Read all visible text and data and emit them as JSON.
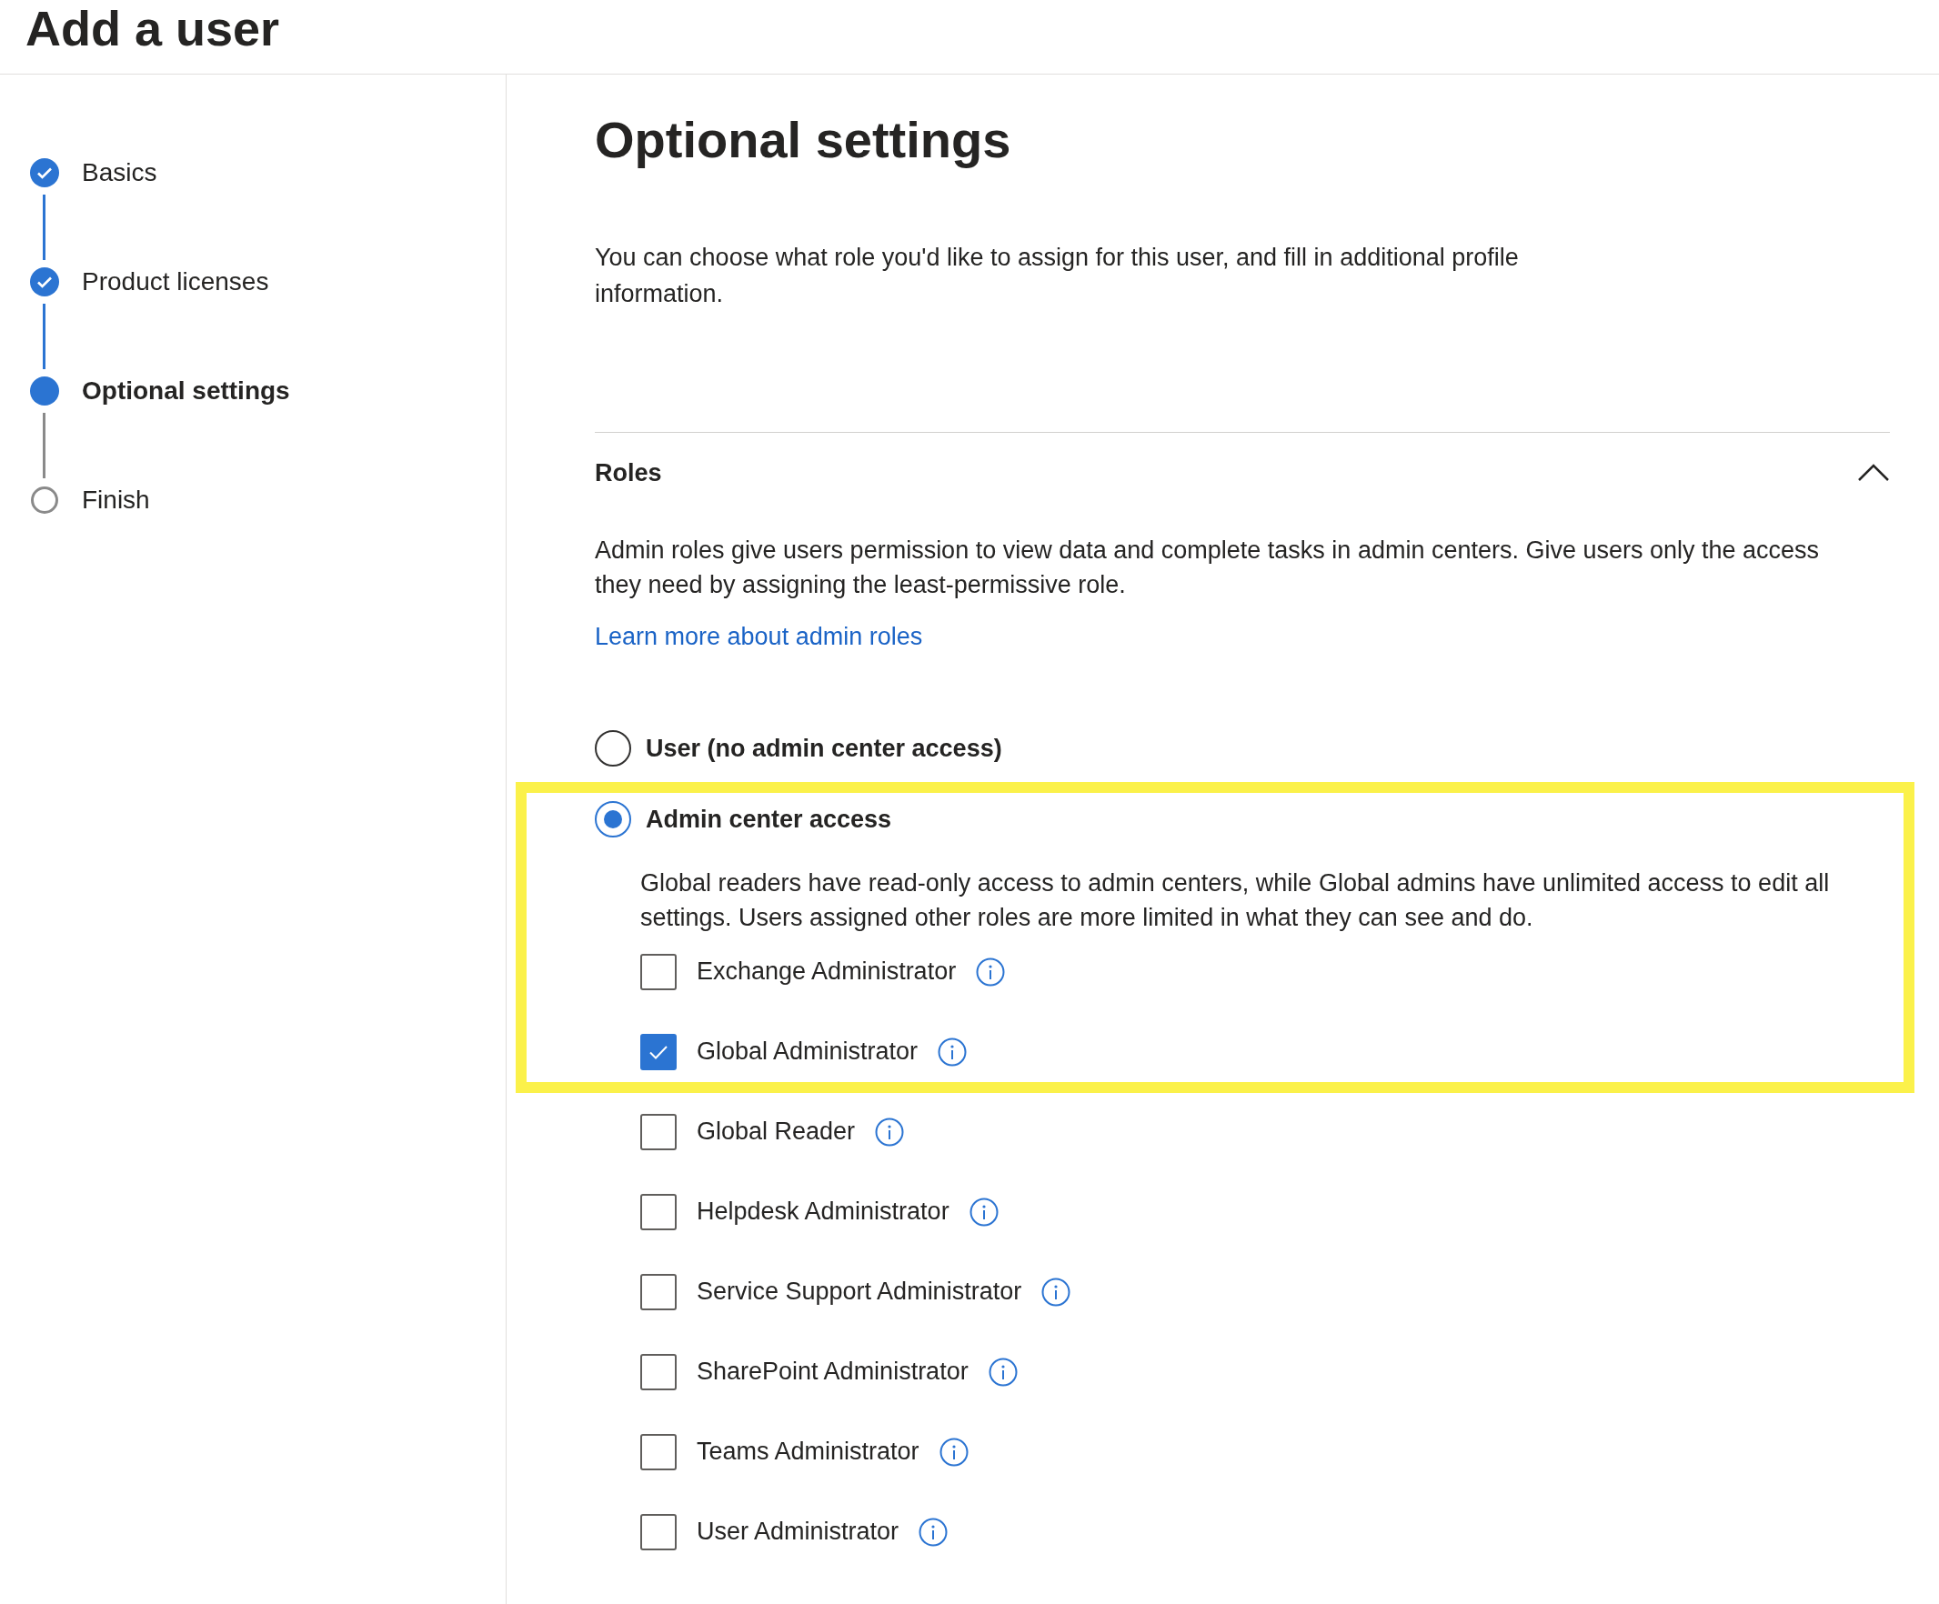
{
  "header": {
    "title": "Add a user"
  },
  "steps": [
    {
      "label": "Basics",
      "completed": true,
      "current": false
    },
    {
      "label": "Product licenses",
      "completed": true,
      "current": false
    },
    {
      "label": "Optional settings",
      "completed": false,
      "current": true
    },
    {
      "label": "Finish",
      "completed": false,
      "current": false
    }
  ],
  "main": {
    "title": "Optional settings",
    "description": "You can choose what role you'd like to assign for this user, and fill in additional profile information."
  },
  "roles": {
    "title": "Roles",
    "expanded": true,
    "description": "Admin roles give users permission to view data and complete tasks in admin centers. Give users only the access they need by assigning the least-permissive role.",
    "link": "Learn more about admin roles",
    "options": [
      {
        "label": "User (no admin center access)",
        "selected": false
      },
      {
        "label": "Admin center access",
        "selected": true
      }
    ],
    "admin_description": "Global readers have read-only access to admin centers, while Global admins have unlimited access to edit all settings. Users assigned other roles are more limited in what they can see and do.",
    "admin_roles": [
      {
        "label": "Exchange Administrator",
        "checked": false
      },
      {
        "label": "Global Administrator",
        "checked": true
      },
      {
        "label": "Global Reader",
        "checked": false
      },
      {
        "label": "Helpdesk Administrator",
        "checked": false
      },
      {
        "label": "Service Support Administrator",
        "checked": false
      },
      {
        "label": "SharePoint Administrator",
        "checked": false
      },
      {
        "label": "Teams Administrator",
        "checked": false
      },
      {
        "label": "User Administrator",
        "checked": false
      }
    ]
  }
}
